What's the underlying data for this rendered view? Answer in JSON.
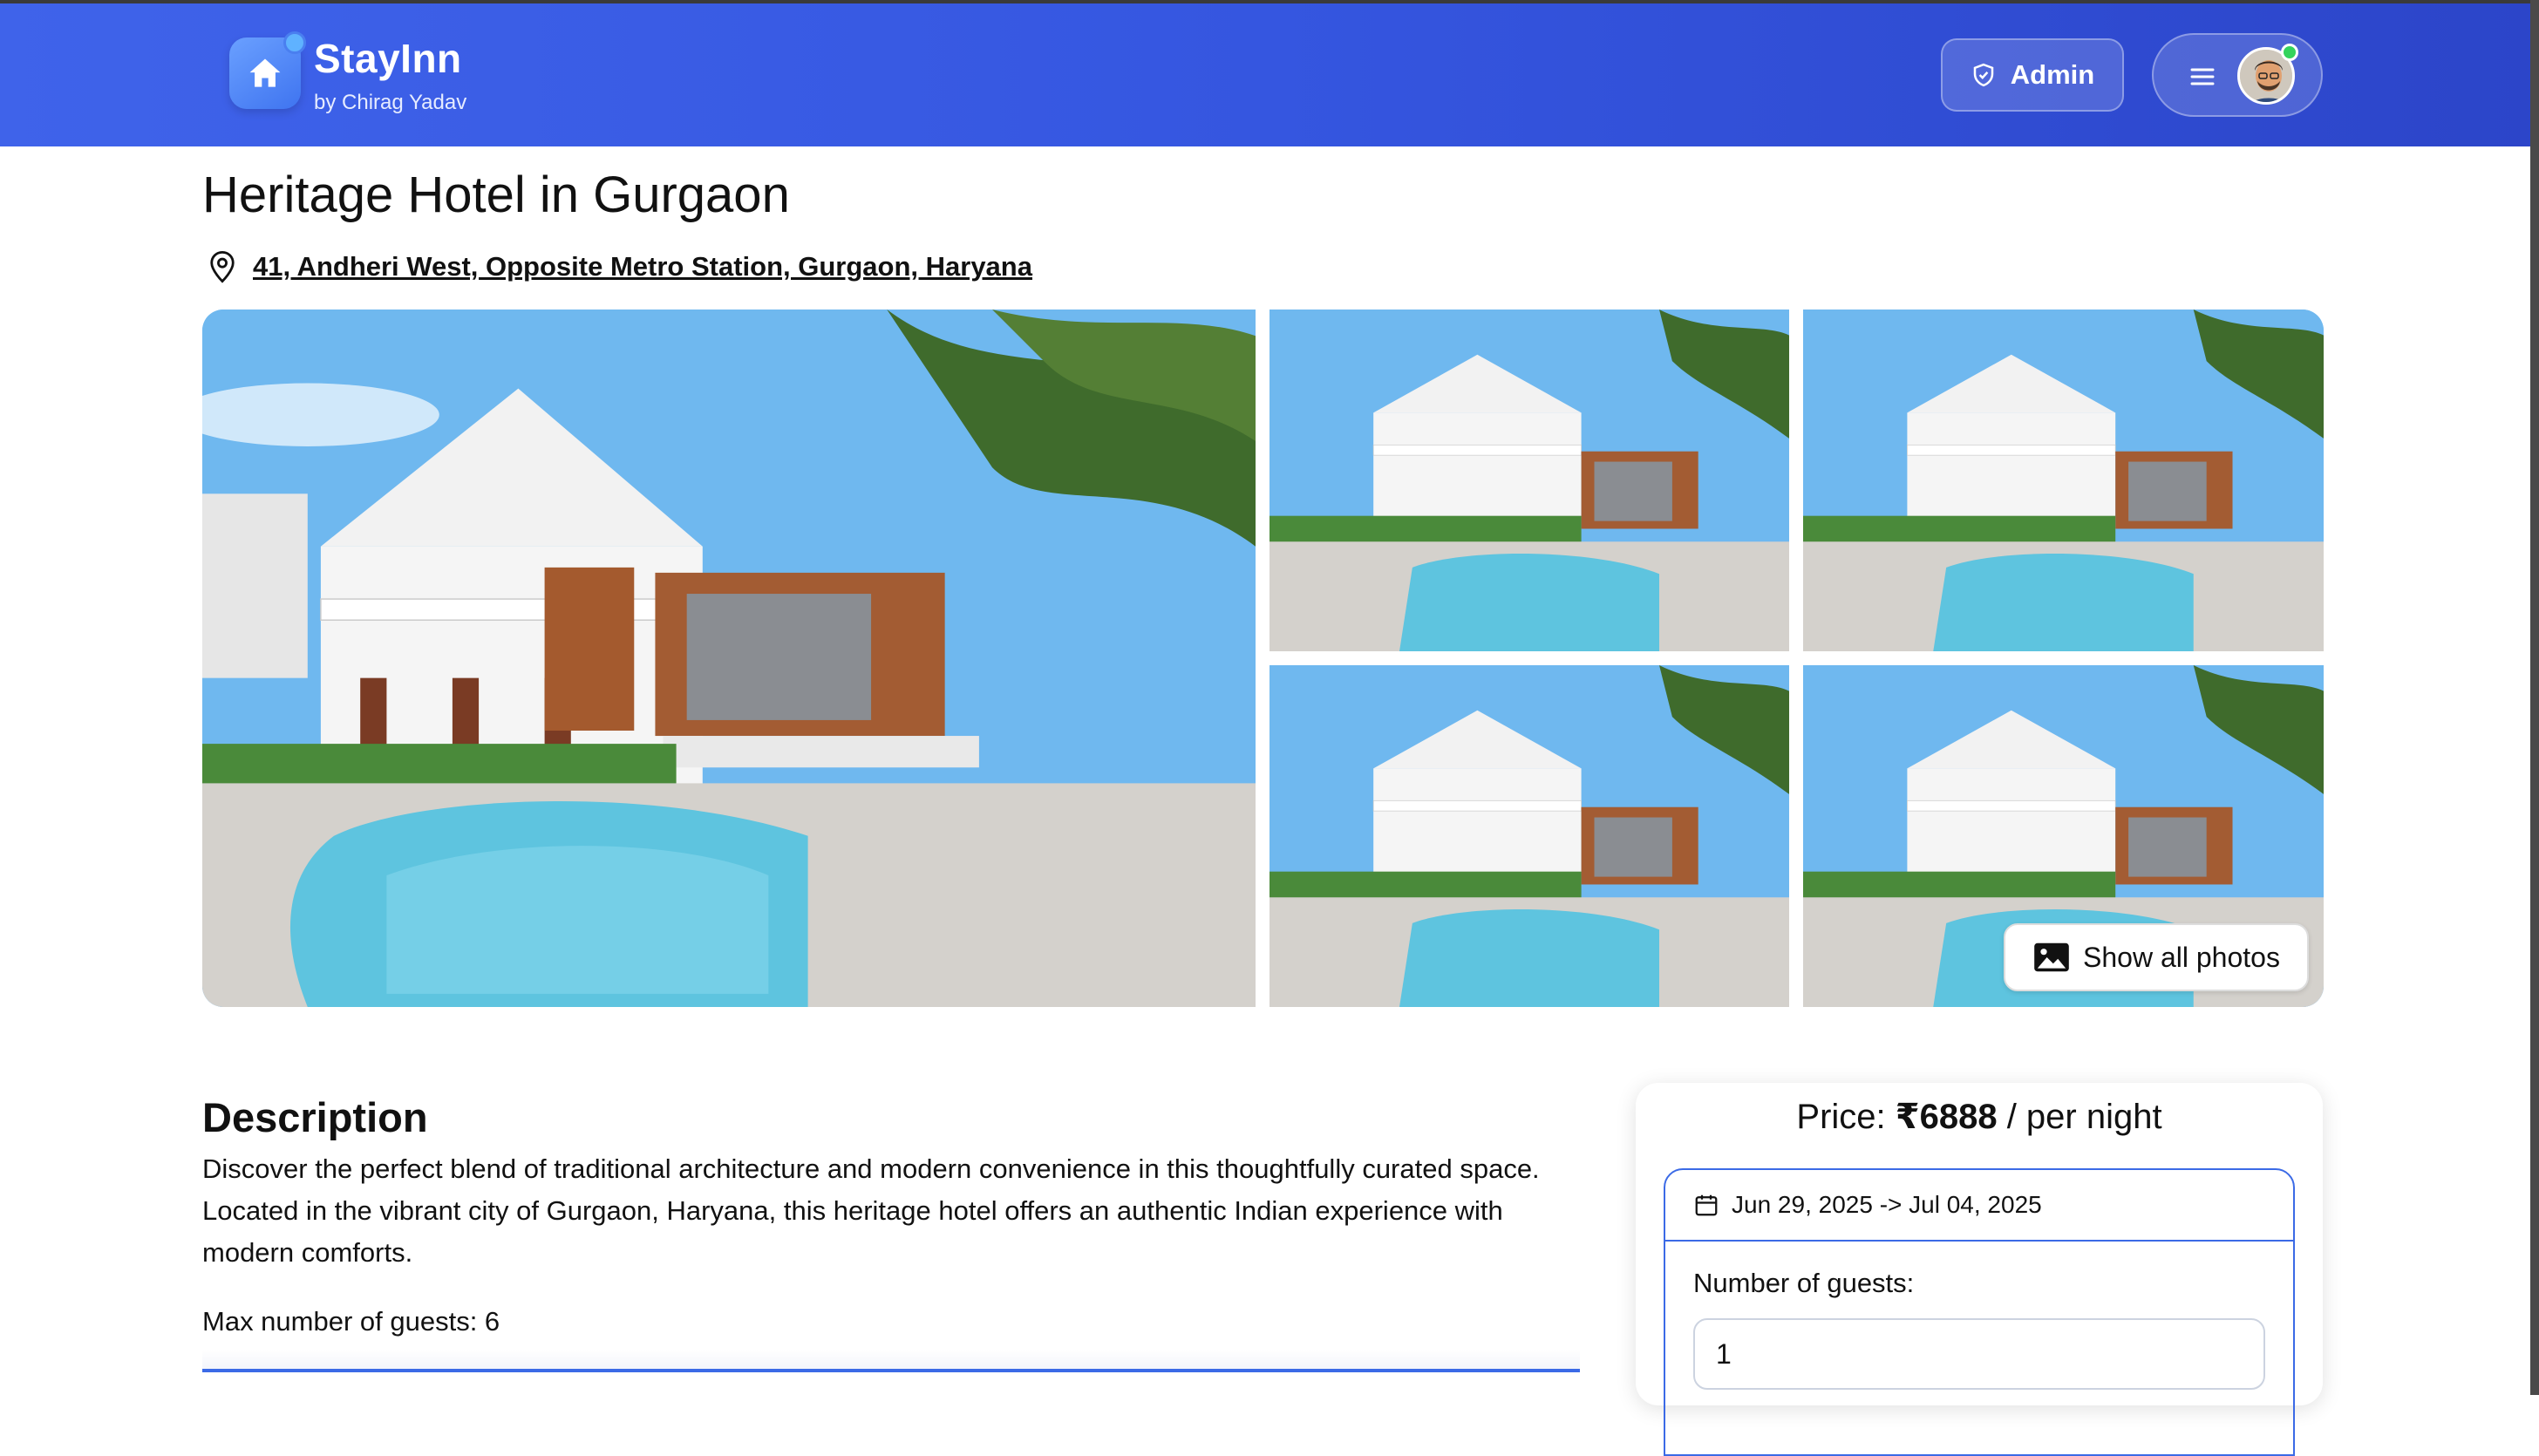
{
  "header": {
    "brand": "StayInn",
    "byline": "by Chirag Yadav",
    "admin_label": "Admin",
    "icons": [
      "home-icon",
      "shield-icon",
      "menu-icon",
      "avatar"
    ],
    "colors": {
      "header_start": "#3f63ea",
      "header_end": "#2c45c9",
      "online": "#33d35c"
    }
  },
  "listing": {
    "title": "Heritage Hotel in Gurgaon",
    "address": "41, Andheri West, Opposite Metro Station, Gurgaon, Haryana",
    "show_all_photos": "Show all photos"
  },
  "description": {
    "heading": "Description",
    "text": "Discover the perfect blend of traditional architecture and modern convenience in this thoughtfully curated space. Located in the vibrant city of Gurgaon, Haryana, this heritage hotel offers an authentic Indian experience with modern comforts.",
    "max_guests": "Max number of guests: 6"
  },
  "booking": {
    "price_prefix": "Price: ",
    "price_value": "₹6888",
    "price_suffix": " / per night",
    "dates": "Jun 29, 2025 -> Jul 04, 2025",
    "guests_label": "Number of guests:",
    "guests_value": "1",
    "accent": "#3b6ae6"
  }
}
